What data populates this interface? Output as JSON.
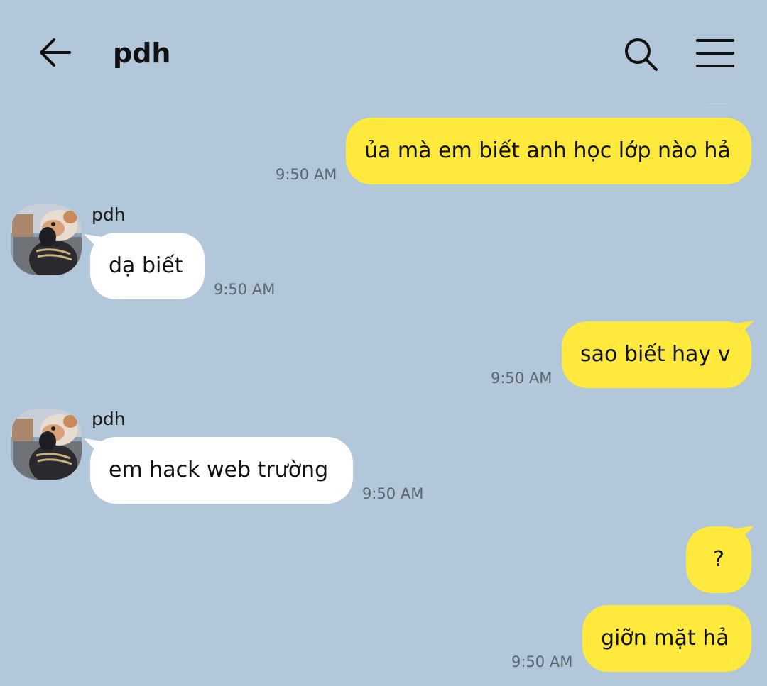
{
  "header": {
    "title": "pdh",
    "back_icon": "arrow-left-icon",
    "search_icon": "search-icon",
    "menu_icon": "hamburger-menu-icon"
  },
  "colors": {
    "background": "#b2c7da",
    "my_bubble": "#fee93c",
    "their_bubble": "#ffffff",
    "time_text": "#5b6670"
  },
  "messages": [
    {
      "sender": "me",
      "text": "ủa mà em biết anh học lớp nào hả",
      "time": "9:50 AM"
    },
    {
      "sender": "pdh",
      "sender_name": "pdh",
      "text": "dạ biết",
      "time": "9:50 AM"
    },
    {
      "sender": "me",
      "text": "sao biết hay v",
      "time": "9:50 AM"
    },
    {
      "sender": "pdh",
      "sender_name": "pdh",
      "text": "em hack web trường",
      "time": "9:50 AM"
    },
    {
      "sender": "me",
      "text": "?",
      "time": ""
    },
    {
      "sender": "me",
      "text": "giỡn mặt hả",
      "time": "9:50 AM"
    }
  ]
}
